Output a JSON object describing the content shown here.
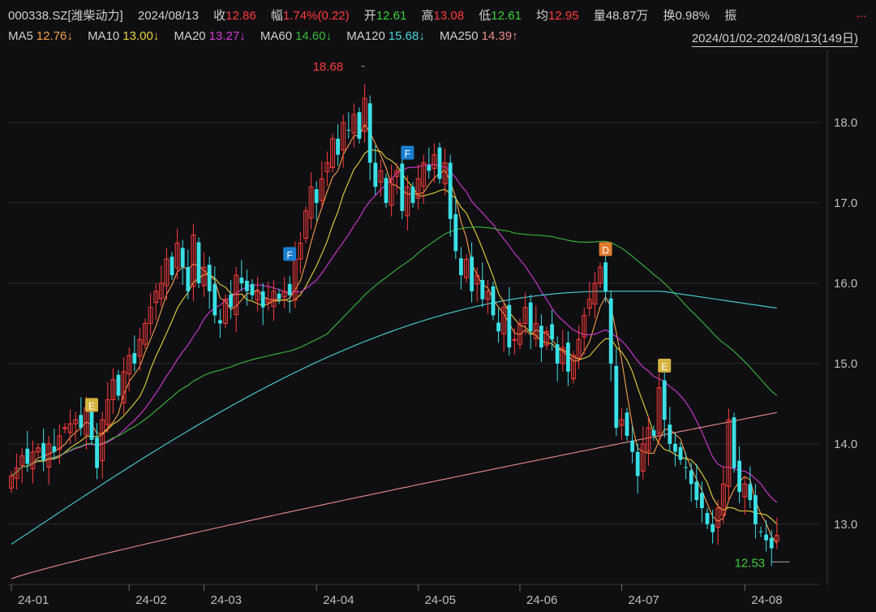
{
  "colors": {
    "up": "#ff3b3b",
    "down": "#3ae0e6",
    "neutral": "#dddddd",
    "ma5": "#f5a04a",
    "ma10": "#e8d33a",
    "ma20": "#d43ad4",
    "ma60": "#3bb83b",
    "ma120": "#4ad4d4",
    "ma250": "#e88c88",
    "grid": "#2a2a2e",
    "label": "#bdbdbd",
    "badgeF": "#1a7ecf",
    "badgeE": "#d4b23e",
    "badgeD": "#e07b2f"
  },
  "header": {
    "code_name": "000338.SZ[潍柴动力]",
    "date": "2024/08/13",
    "close_label": "收",
    "close_value": "12.86",
    "change_label": "幅",
    "change_value": "1.74%(0.22)",
    "open_label": "开",
    "open_value": "12.61",
    "high_label": "高",
    "high_value": "13.08",
    "low_label": "低",
    "low_value": "12.61",
    "avg_label": "均",
    "avg_value": "12.95",
    "volume_label": "量",
    "volume_value": "48.87万",
    "turnover_label": "换",
    "turnover_value": "0.98%",
    "amplitude_label": "振",
    "more": "..."
  },
  "ma_bar": {
    "ma5_label": "MA5",
    "ma5_value": "12.76↓",
    "ma10_label": "MA10",
    "ma10_value": "13.00↓",
    "ma20_label": "MA20",
    "ma20_value": "13.27↓",
    "ma60_label": "MA60",
    "ma60_value": "14.60↓",
    "ma120_label": "MA120",
    "ma120_value": "15.68↓",
    "ma250_label": "MA250",
    "ma250_value": "14.39↑",
    "date_range": "2024/01/02-2024/08/13(149日)"
  },
  "chart_data": {
    "type": "candlestick",
    "ylim": [
      12.25,
      18.9
    ],
    "y_ticks": [
      13.0,
      14.0,
      15.0,
      16.0,
      17.0,
      18.0
    ],
    "x_ticks": [
      {
        "label": "24-01",
        "index": 0
      },
      {
        "label": "24-02",
        "index": 22
      },
      {
        "label": "24-03",
        "index": 36
      },
      {
        "label": "24-04",
        "index": 57
      },
      {
        "label": "24-05",
        "index": 76
      },
      {
        "label": "24-06",
        "index": 95
      },
      {
        "label": "24-07",
        "index": 114
      },
      {
        "label": "24-08",
        "index": 137
      }
    ],
    "annotations": [
      {
        "text": "18.68",
        "index": 66,
        "value": 18.68,
        "kind": "high"
      },
      {
        "text": "12.53",
        "index": 146,
        "value": 12.53,
        "kind": "low"
      }
    ],
    "badges": [
      {
        "text": "E",
        "index": 15,
        "value": 14.48
      },
      {
        "text": "F",
        "index": 52,
        "value": 16.36
      },
      {
        "text": "F",
        "index": 74,
        "value": 17.62
      },
      {
        "text": "D",
        "index": 111,
        "value": 16.42
      },
      {
        "text": "E",
        "index": 122,
        "value": 14.97
      }
    ],
    "closes": [
      13.6,
      13.7,
      13.85,
      13.75,
      13.9,
      13.95,
      13.8,
      14.0,
      13.9,
      14.1,
      14.2,
      14.25,
      14.3,
      14.2,
      14.45,
      14.05,
      13.7,
      14.3,
      14.55,
      14.8,
      14.6,
      14.9,
      15.1,
      15.0,
      15.3,
      15.5,
      15.7,
      15.9,
      16.0,
      16.3,
      16.1,
      16.5,
      16.2,
      15.9,
      16.6,
      16.0,
      16.2,
      15.9,
      15.6,
      15.5,
      15.8,
      15.7,
      16.1,
      16.0,
      15.9,
      15.85,
      15.9,
      15.7,
      15.8,
      15.9,
      15.8,
      15.9,
      15.85,
      16.3,
      16.5,
      16.9,
      17.2,
      17.0,
      17.3,
      17.5,
      17.8,
      17.6,
      18.0,
      17.9,
      18.1,
      17.8,
      18.3,
      17.5,
      17.2,
      17.4,
      17.0,
      17.3,
      17.4,
      16.9,
      17.2,
      17.0,
      17.3,
      17.5,
      17.4,
      17.6,
      17.3,
      17.5,
      16.8,
      16.4,
      16.1,
      16.3,
      15.9,
      16.1,
      15.8,
      15.9,
      15.6,
      15.4,
      15.7,
      15.2,
      15.3,
      15.5,
      15.7,
      15.4,
      15.5,
      15.2,
      15.4,
      15.3,
      15.0,
      15.2,
      14.9,
      15.1,
      15.3,
      15.6,
      15.8,
      16.0,
      16.2,
      15.9,
      15.0,
      14.2,
      14.3,
      14.1,
      13.9,
      13.6,
      14.0,
      14.2,
      14.1,
      14.7,
      14.3,
      14.0,
      13.9,
      13.8,
      13.7,
      13.5,
      13.3,
      13.2,
      13.0,
      12.9,
      13.2,
      13.5,
      14.3,
      13.7,
      13.4,
      13.5,
      13.3,
      13.0,
      12.9,
      12.8,
      12.7,
      12.86
    ],
    "ma_endpoints": {
      "ma5": 12.76,
      "ma10": 13.0,
      "ma20": 13.27,
      "ma60": 14.6,
      "ma120": 15.68,
      "ma250": 14.39
    }
  }
}
